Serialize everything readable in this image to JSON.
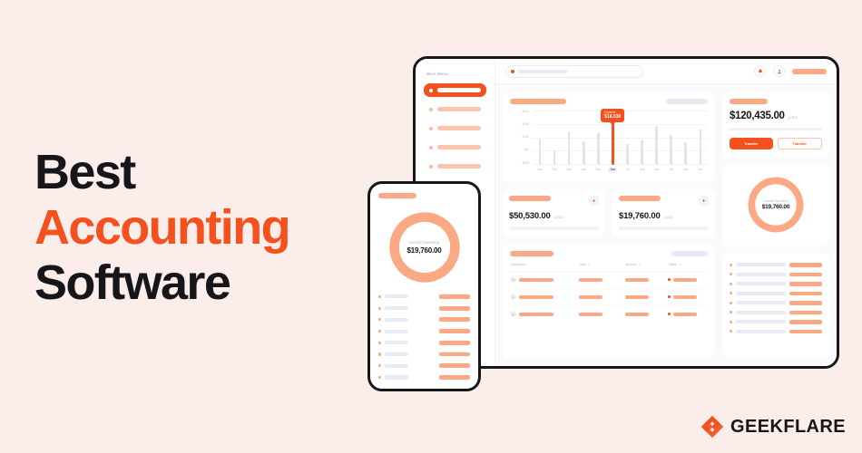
{
  "banner": {
    "background_color": "#FBEDE9",
    "headline": {
      "line1": "Best",
      "line2": "Accounting",
      "line3": "Software",
      "accent_color": "#F4511E",
      "text_color": "#16161a"
    },
    "logo": {
      "text": "GEEKFLARE",
      "mark_icon": "geekflare-g-mark-icon",
      "mark_color": "#F4511E"
    }
  },
  "dashboard": {
    "topbar": {
      "search_placeholder": "",
      "search_icon": "search-icon",
      "notification_icon": "bell-icon",
      "account_icon": "user-icon",
      "profile_pill": ""
    },
    "sidebar": {
      "title": "Main Menu",
      "items": [
        {
          "label": "",
          "active": true
        },
        {
          "label": "",
          "active": false
        },
        {
          "label": "",
          "active": false
        },
        {
          "label": "",
          "active": false
        },
        {
          "label": "",
          "active": false
        }
      ]
    },
    "chart_data": {
      "type": "bar",
      "title": "",
      "xlabel": "",
      "ylabel": "",
      "categories": [
        "Jan",
        "Feb",
        "Mar",
        "Apr",
        "May",
        "Jun",
        "Jul",
        "Aug",
        "Sep",
        "Oct",
        "Nov",
        "Dec"
      ],
      "values": [
        9800,
        5200,
        12500,
        8600,
        11800,
        16030,
        7600,
        9200,
        14500,
        11000,
        8200,
        13200
      ],
      "ylim": [
        0,
        20000
      ],
      "yticks": [
        "$20k",
        "$15k",
        "$10k",
        "$5k",
        "$500"
      ],
      "highlight_category": "Jun",
      "bar_color": "#dfe4f5",
      "highlight_color": "#F4511E",
      "grid": true,
      "legend": "",
      "tooltip": {
        "label": "Expense",
        "value": "$16,030",
        "category": "Jun"
      }
    },
    "stats": [
      {
        "tag": "",
        "amount": "$50,530.00",
        "currency": "(USD)",
        "icon": "arrow-up-icon"
      },
      {
        "tag": "",
        "amount": "$19,760.00",
        "currency": "(USD)",
        "icon": "arrow-down-icon"
      }
    ],
    "transactions": {
      "title": "",
      "action": "",
      "columns": [
        "Transaction",
        "Date",
        "Amount",
        "Status"
      ],
      "sort_icon": "chevron-down-icon",
      "row_icon": "user-avatar-icon",
      "rows": [
        {
          "transaction": "",
          "date": "",
          "amount": "",
          "status": ""
        },
        {
          "transaction": "",
          "date": "",
          "amount": "",
          "status": ""
        },
        {
          "transaction": "",
          "date": "",
          "amount": "",
          "status": ""
        }
      ]
    },
    "balance": {
      "tag": "",
      "amount": "$120,435.00",
      "currency": "(USD)",
      "primary_button": "Transfer",
      "secondary_button": "Transfer"
    },
    "donut": {
      "label": "Overall Spending",
      "value": "$19,760.00",
      "segment_color": "#FBA984",
      "segments": 9
    },
    "side_list": {
      "rows": [
        {
          "name": "",
          "value": ""
        },
        {
          "name": "",
          "value": ""
        },
        {
          "name": "",
          "value": ""
        },
        {
          "name": "",
          "value": ""
        },
        {
          "name": "",
          "value": ""
        },
        {
          "name": "",
          "value": ""
        },
        {
          "name": "",
          "value": ""
        },
        {
          "name": "",
          "value": ""
        }
      ]
    }
  },
  "phone": {
    "tag": "",
    "donut": {
      "label": "Overall Spending",
      "value": "$19,760.00",
      "segment_color": "#FBA984",
      "segments": 9
    },
    "list": {
      "rows": [
        {
          "name": "",
          "value": ""
        },
        {
          "name": "",
          "value": ""
        },
        {
          "name": "",
          "value": ""
        },
        {
          "name": "",
          "value": ""
        },
        {
          "name": "",
          "value": ""
        },
        {
          "name": "",
          "value": ""
        },
        {
          "name": "",
          "value": ""
        },
        {
          "name": "",
          "value": ""
        }
      ]
    }
  }
}
